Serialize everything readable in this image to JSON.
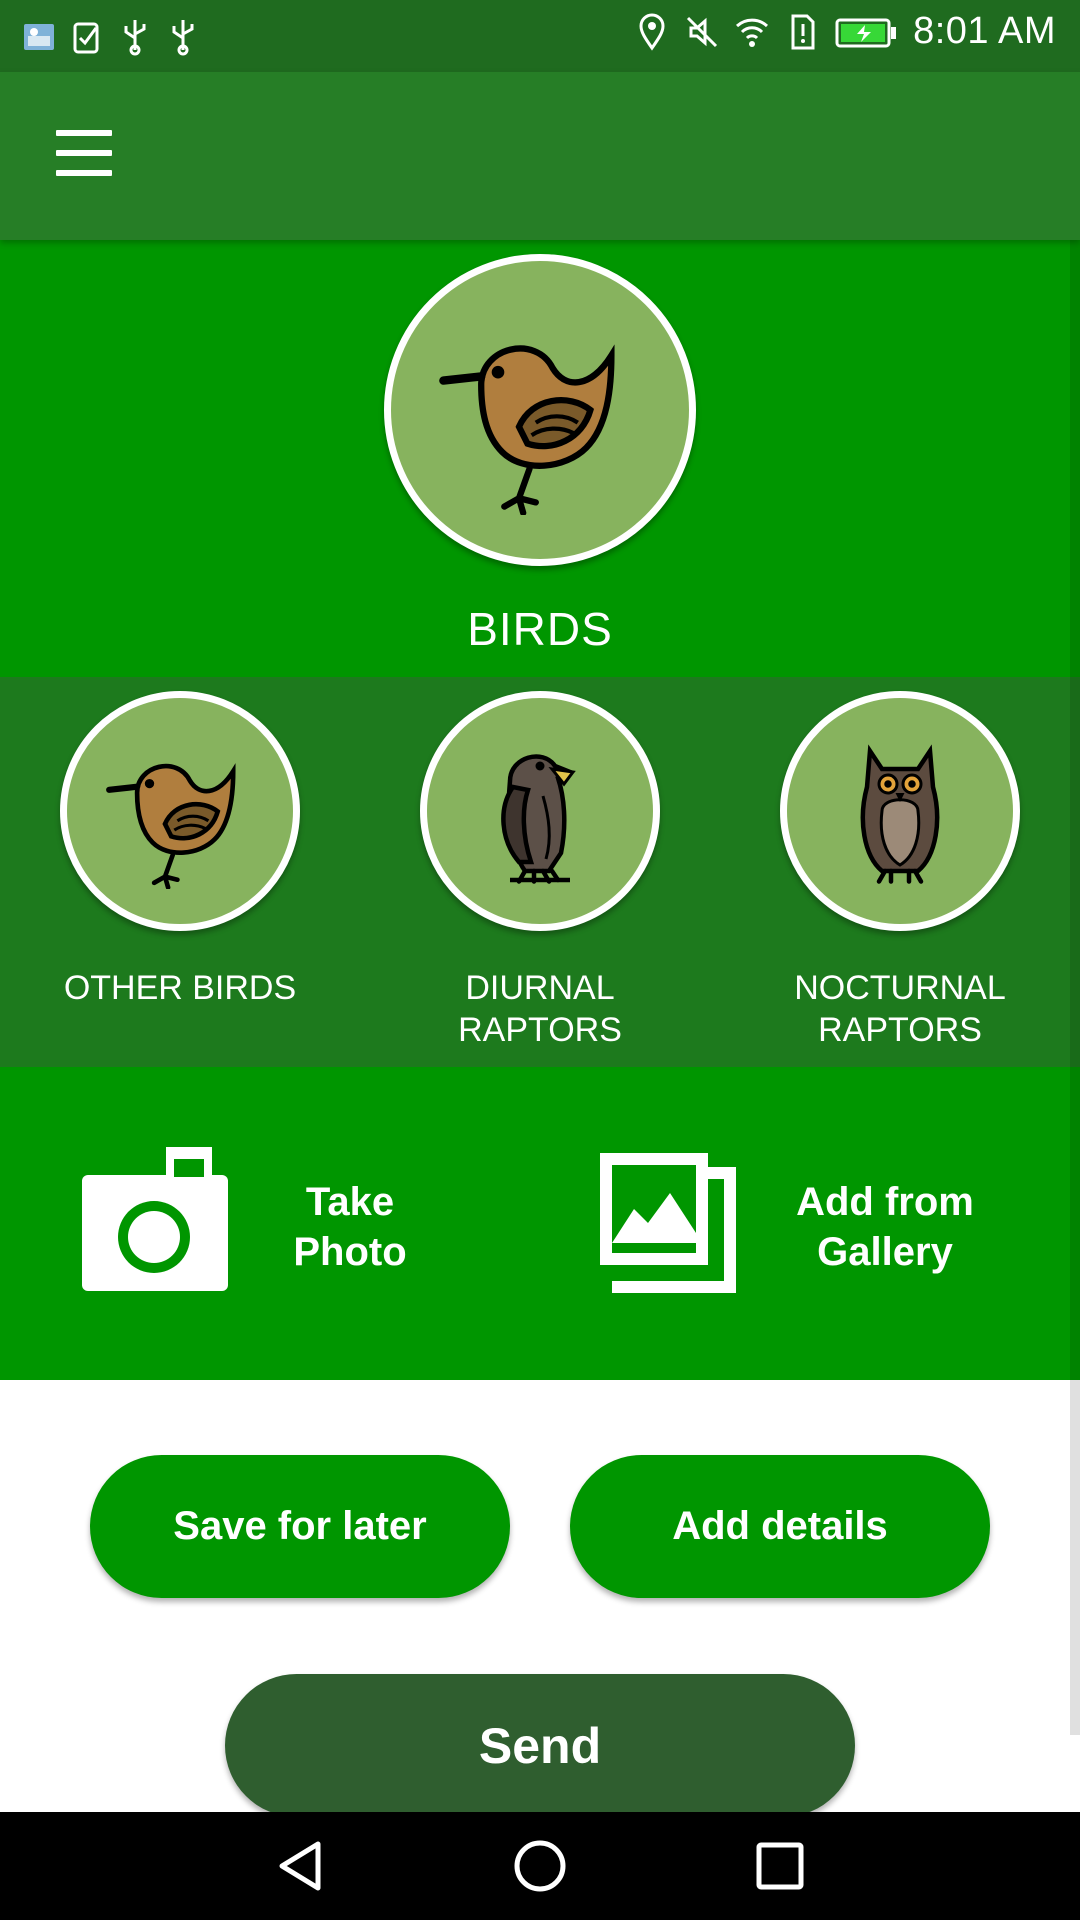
{
  "status_bar": {
    "time": "8:01 AM",
    "left_icons": [
      "weather-icon",
      "clipboard-check-icon",
      "usb-icon",
      "usb-icon"
    ],
    "right_icons": [
      "location-icon",
      "mute-icon",
      "wifi-icon",
      "sim-alert-icon",
      "battery-charging-icon"
    ]
  },
  "app_bar": {
    "menu_icon": "hamburger-menu-icon"
  },
  "category": {
    "label": "BIRDS",
    "icon": "bird-icon"
  },
  "subcategories": [
    {
      "label": "OTHER BIRDS",
      "icon": "bird-icon"
    },
    {
      "label": "DIURNAL\nRAPTORS",
      "icon": "eagle-icon"
    },
    {
      "label": "NOCTURNAL\nRAPTORS",
      "icon": "owl-icon"
    }
  ],
  "photo_actions": {
    "take_photo": {
      "label": "Take\nPhoto",
      "icon": "camera-icon"
    },
    "gallery": {
      "label": "Add from\nGallery",
      "icon": "gallery-icon"
    }
  },
  "buttons": {
    "save_later": "Save for later",
    "add_details": "Add details",
    "send": "Send"
  },
  "nav": {
    "back_icon": "back-icon",
    "home_icon": "home-icon",
    "recents_icon": "recents-icon"
  },
  "colors": {
    "status_bar": "#1f6b1f",
    "app_bar": "#267e26",
    "primary": "#009600",
    "subcategory_bg": "#1d7a1d",
    "circle_fill": "#87b35e",
    "send_button": "#2f5e2f"
  }
}
